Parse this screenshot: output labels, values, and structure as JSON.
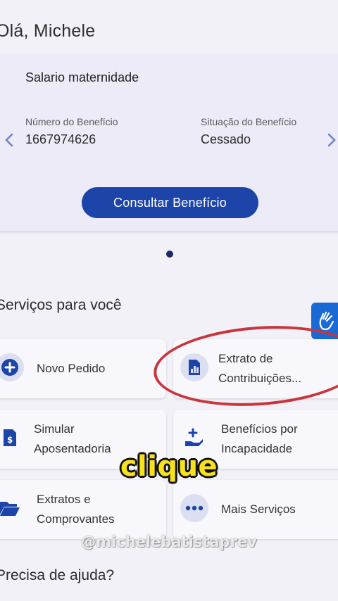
{
  "greeting": "Olá, Michele",
  "benefit": {
    "title": "Salario maternidade",
    "number_label": "Número do Benefício",
    "number_value": "1667974626",
    "status_label": "Situação do Benefício",
    "status_value": "Cessado",
    "button_label": "Consultar Benefício"
  },
  "services": {
    "title": "Serviços para você",
    "tiles": [
      {
        "line1": "Novo Pedido",
        "line2": "",
        "icon": "plus-circle-icon"
      },
      {
        "line1": "Extrato de",
        "line2": "Contribuições...",
        "icon": "document-chart-icon"
      },
      {
        "line1": "Simular",
        "line2": "Aposentadoria",
        "icon": "calculator-document-icon"
      },
      {
        "line1": "Benefícios por",
        "line2": "Incapacidade",
        "icon": "hand-plus-icon"
      },
      {
        "line1": "Extratos e",
        "line2": "Comprovantes",
        "icon": "folder-open-icon"
      },
      {
        "line1": "Mais Serviços",
        "line2": "",
        "icon": "more-dots-icon"
      }
    ]
  },
  "help_title": "Precisa de ajuda?",
  "overlay": {
    "caption": "clique",
    "watermark": "@michelebatistaprev"
  },
  "colors": {
    "primary": "#1d44a8",
    "icon_bg": "#dcdff2",
    "annotation": "#c9343d",
    "caption": "#f6e11c",
    "a11y": "#1a6ad6"
  }
}
